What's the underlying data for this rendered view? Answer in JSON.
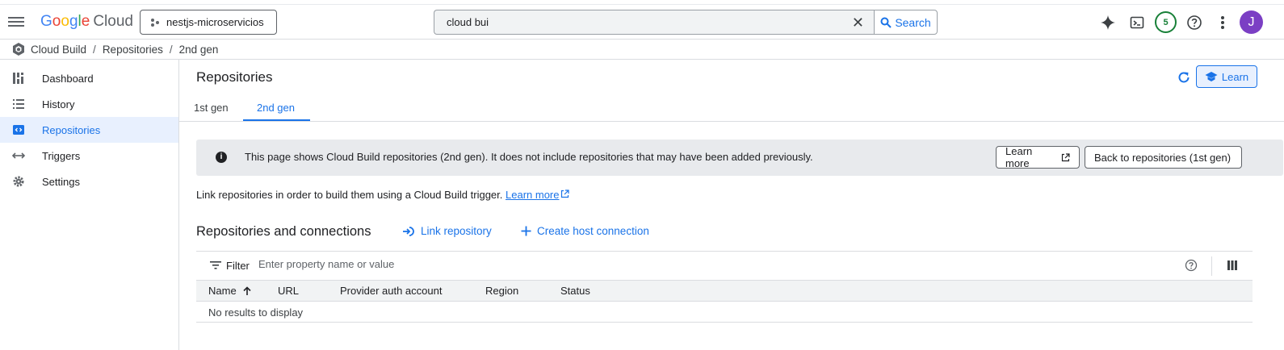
{
  "header": {
    "logo_letters": [
      "G",
      "o",
      "o",
      "g",
      "l",
      "e"
    ],
    "logo_suffix": "Cloud",
    "project_name": "nestjs-microservicios",
    "search_value": "cloud bui",
    "search_label": "Search",
    "notification_count": "5",
    "avatar_initial": "J"
  },
  "breadcrumb": [
    "Cloud Build",
    "Repositories",
    "2nd gen"
  ],
  "sidebar": {
    "items": [
      {
        "label": "Dashboard",
        "icon": "dashboard-icon"
      },
      {
        "label": "History",
        "icon": "list-icon"
      },
      {
        "label": "Repositories",
        "icon": "repository-icon",
        "active": true
      },
      {
        "label": "Triggers",
        "icon": "arrows-icon"
      },
      {
        "label": "Settings",
        "icon": "gear-icon"
      }
    ]
  },
  "main": {
    "title": "Repositories",
    "learn_label": "Learn",
    "tabs": [
      "1st gen",
      "2nd gen"
    ],
    "active_tab": "2nd gen",
    "banner": {
      "text": "This page shows Cloud Build repositories (2nd gen). It does not include repositories that may have been added previously.",
      "learn_more": "Learn more",
      "back_label": "Back to repositories (1st gen)"
    },
    "link_text": "Link repositories in order to build them using a Cloud Build trigger.",
    "link_learn_more": "Learn more",
    "section_title": "Repositories and connections",
    "actions": {
      "link_repository": "Link repository",
      "create_host_connection": "Create host connection"
    },
    "filter": {
      "label": "Filter",
      "placeholder": "Enter property name or value"
    },
    "table": {
      "columns": [
        "Name",
        "URL",
        "Provider auth account",
        "Region",
        "Status"
      ],
      "empty_text": "No results to display"
    }
  },
  "colors": {
    "accent": "#1a73e8",
    "active_bg": "#e8f0fe",
    "badge_green": "#188038",
    "avatar": "#7b3fc4"
  }
}
